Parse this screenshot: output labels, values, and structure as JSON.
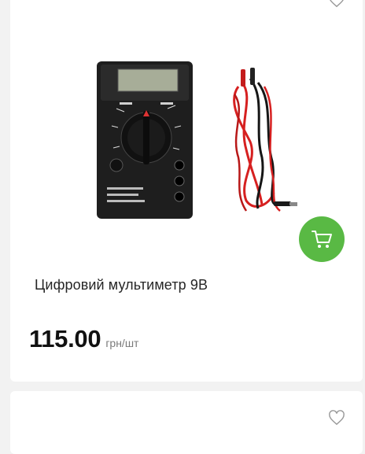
{
  "product": {
    "title": "Цифровий мультиметр 9В",
    "price": "115.00",
    "unit": "грн/шт",
    "image_icon": "multimeter-image",
    "cart_icon": "cart-icon",
    "wishlist_icon": "heart-icon"
  },
  "colors": {
    "cart_button": "#59b944",
    "background": "#f2f2f2",
    "card": "#ffffff"
  }
}
